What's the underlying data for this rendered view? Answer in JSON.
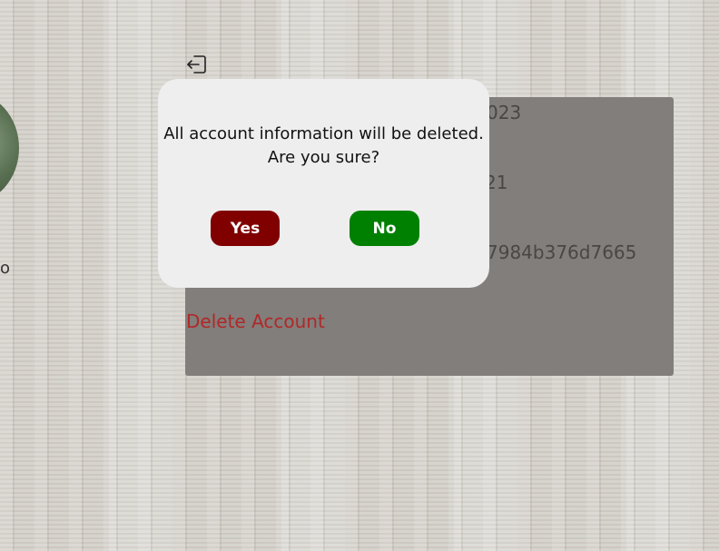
{
  "profile": {
    "name_fragment": "o"
  },
  "account_panel": {
    "line1": "023",
    "line2": "21",
    "line3": "7984b376d7665",
    "delete_label": "Delete Account"
  },
  "dialog": {
    "message_line1": "All account information will be deleted.",
    "message_line2": "Are you sure?",
    "yes_label": "Yes",
    "no_label": "No"
  },
  "colors": {
    "yes_button": "#800000",
    "no_button": "#008000",
    "delete_link": "#b02828",
    "panel": "#827e7b",
    "dialog_bg": "#eeeeee"
  },
  "icons": {
    "logout": "logout-icon"
  }
}
